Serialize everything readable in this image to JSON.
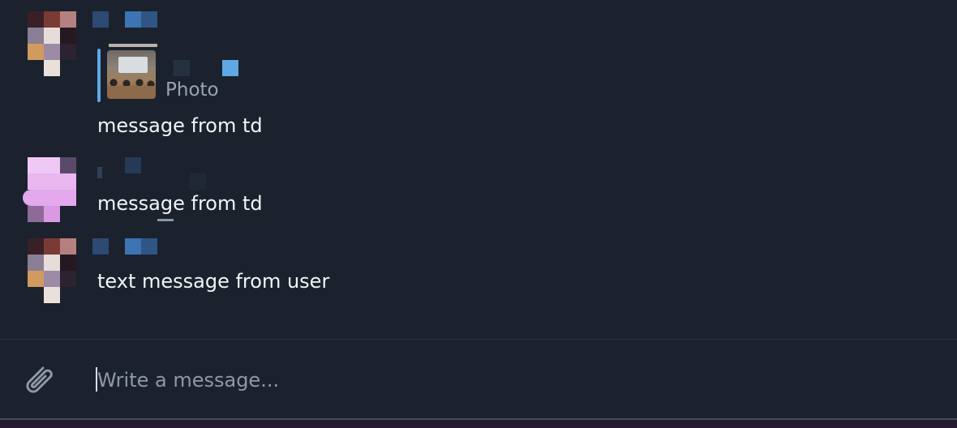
{
  "messages": [
    {
      "reply_preview": {
        "label": "Photo"
      },
      "text": "message from td"
    },
    {
      "text": "message from td"
    },
    {
      "text": "text message from user"
    }
  ],
  "composer": {
    "placeholder": "Write a message..."
  },
  "icons": {
    "attach": "paperclip-icon"
  },
  "colors": {
    "background": "#1b222d",
    "accent": "#5ea8e6",
    "text": "#f2f4f7",
    "placeholder": "#8f98a5"
  }
}
